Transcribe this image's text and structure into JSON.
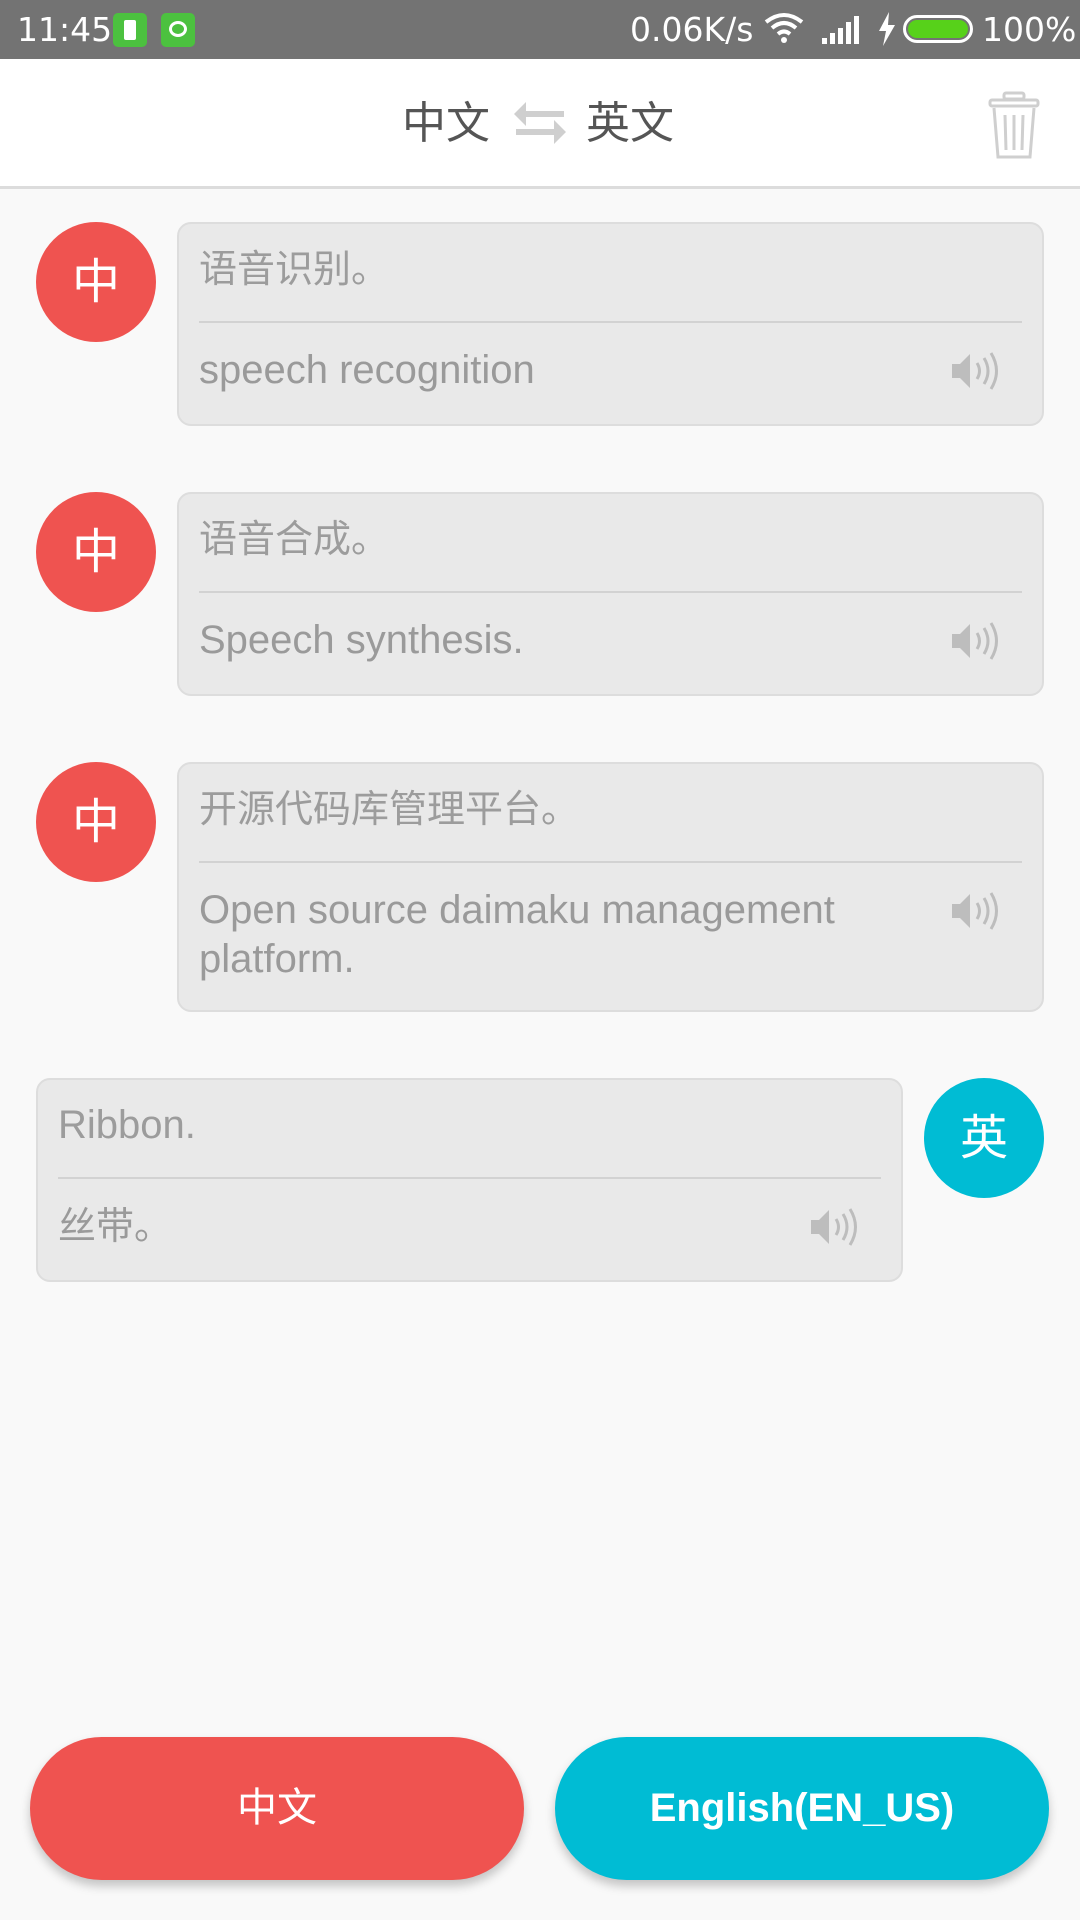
{
  "status_bar": {
    "time": "11:45",
    "net_speed": "0.06K/s",
    "battery_pct": "100%",
    "battery_level": 1.0
  },
  "header": {
    "source_lang": "中文",
    "target_lang": "英文",
    "swap_icon": "swap-arrows-icon",
    "clear_icon": "trash-icon"
  },
  "messages": [
    {
      "speaker": "中",
      "side": "left",
      "source": "语音识别。",
      "translation": "speech recognition"
    },
    {
      "speaker": "中",
      "side": "left",
      "source": "语音合成。",
      "translation": "Speech synthesis."
    },
    {
      "speaker": "中",
      "side": "left",
      "source": "开源代码库管理平台。",
      "translation": "Open source daimaku management platform."
    },
    {
      "speaker": "英",
      "side": "right",
      "source": "Ribbon.",
      "translation": "丝带。"
    }
  ],
  "buttons": {
    "chinese": "中文",
    "english": "English(EN_US)"
  },
  "colors": {
    "chinese_accent": "#ef5350",
    "english_accent": "#00bcd4",
    "status_bar": "#737373",
    "battery_fill": "#57d11a"
  }
}
